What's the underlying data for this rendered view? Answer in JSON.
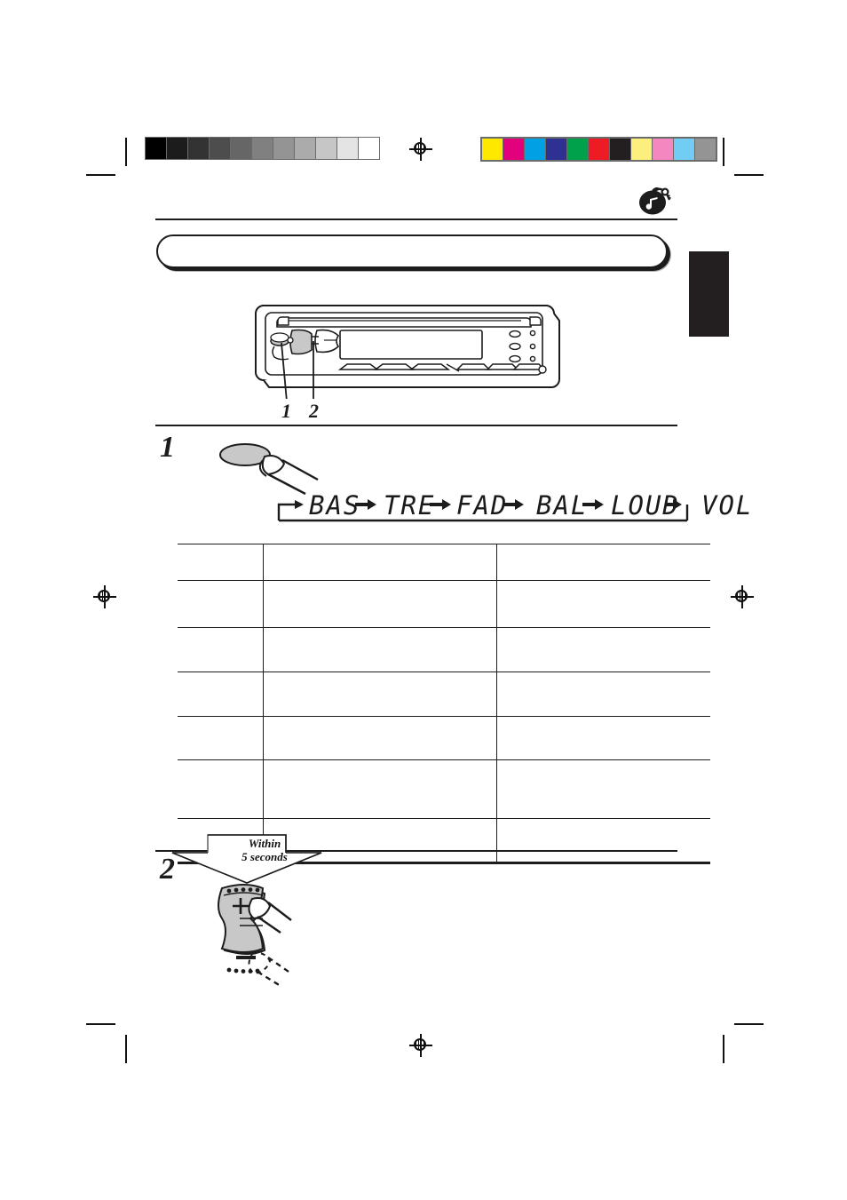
{
  "page": {
    "title_bar_text": "",
    "top_rule": true,
    "side_tab_color": "#231f20",
    "icon": "music-bag-key-icon"
  },
  "calibration": {
    "gray_bar_label": "grayscale-calibration-bar",
    "gray_swatches": [
      "#000000",
      "#1c1c1c",
      "#333333",
      "#4d4d4d",
      "#666666",
      "#808080",
      "#949494",
      "#ababab",
      "#c6c6c6",
      "#e4e4e4",
      "#ffffff"
    ],
    "color_bar_label": "color-calibration-bar",
    "color_swatches": [
      "#ffe800",
      "#e2007d",
      "#00a0e4",
      "#2e3192",
      "#00a14b",
      "#ed1c24",
      "#231f20",
      "#fdef7e",
      "#f387c0",
      "#72cdf4",
      "#949494"
    ],
    "registration_mark": "registration-target-icon"
  },
  "unit": {
    "illustration_label": "car-stereo-faceplate-illustration",
    "callout_labels": [
      "1",
      "2"
    ],
    "display_window_label": "lcd-display-window"
  },
  "step1": {
    "number": "1",
    "hand_icon": "pressing-hand-icon",
    "lcd_sequence": [
      "BAS",
      "TRE",
      "FAD",
      "BAL",
      "LOUD",
      "VOL"
    ],
    "lcd_arrow": "→",
    "lcd_loop_label": "repeat-loop-bracket"
  },
  "table": {
    "columns": [
      "",
      "",
      ""
    ],
    "rows": [
      [
        "",
        "",
        ""
      ],
      [
        "",
        "",
        ""
      ],
      [
        "",
        "",
        ""
      ],
      [
        "",
        "",
        ""
      ],
      [
        "",
        "",
        ""
      ],
      [
        "",
        "",
        ""
      ],
      [
        "",
        "",
        ""
      ]
    ]
  },
  "step2": {
    "number": "2",
    "banner_line1": "Within",
    "banner_line2": "5 seconds",
    "knob_icon": "rocker-control-illustration",
    "plus_label": "+",
    "minus_label": "−"
  }
}
